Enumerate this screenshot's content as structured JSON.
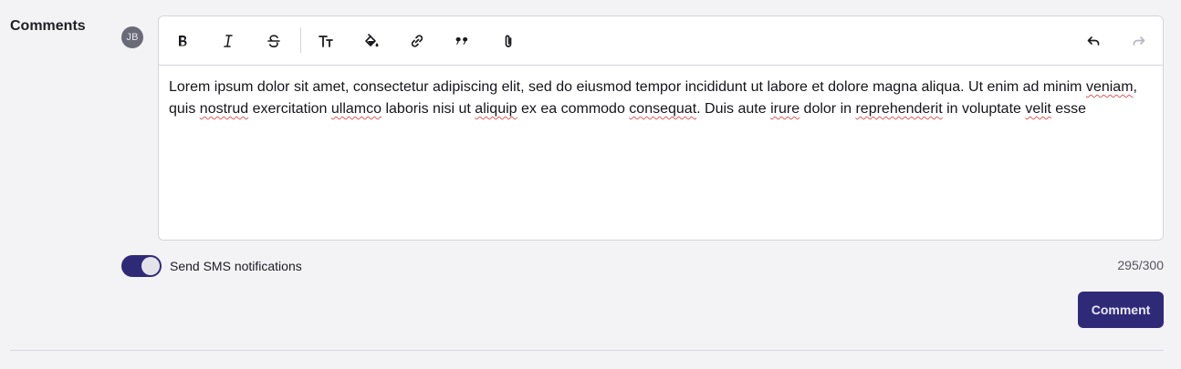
{
  "comments": {
    "section_label": "Comments",
    "avatar_initials": "JB",
    "toolbar": {
      "left_tools": [
        "bold-icon",
        "italic-icon",
        "strikethrough-icon",
        "text-size-icon",
        "fill-color-icon",
        "link-icon",
        "quote-icon",
        "attachment-icon"
      ],
      "right_tools": [
        "undo-icon",
        "redo-icon"
      ],
      "redo_enabled": false
    },
    "content_segments": [
      {
        "text": "Lorem ipsum dolor sit amet, consectetur adipiscing elit, sed do eiusmod tempor incididunt ut labore et dolore magna aliqua. Ut enim ad minim ",
        "misspelled": false
      },
      {
        "text": "veniam",
        "misspelled": true
      },
      {
        "text": ", quis ",
        "misspelled": false
      },
      {
        "text": "nostrud",
        "misspelled": true
      },
      {
        "text": " exercitation ",
        "misspelled": false
      },
      {
        "text": "ullamco",
        "misspelled": true
      },
      {
        "text": " laboris nisi ut ",
        "misspelled": false
      },
      {
        "text": "aliquip",
        "misspelled": true
      },
      {
        "text": " ex ea commodo ",
        "misspelled": false
      },
      {
        "text": "consequat",
        "misspelled": true
      },
      {
        "text": ". Duis aute ",
        "misspelled": false
      },
      {
        "text": "irure",
        "misspelled": true
      },
      {
        "text": " dolor in ",
        "misspelled": false
      },
      {
        "text": "reprehenderit",
        "misspelled": true
      },
      {
        "text": " in voluptate ",
        "misspelled": false
      },
      {
        "text": "velit",
        "misspelled": true
      },
      {
        "text": " esse",
        "misspelled": false
      }
    ],
    "sms_toggle": {
      "label": "Send SMS notifications",
      "enabled": true
    },
    "char_count": "295/300",
    "submit_label": "Comment"
  },
  "colors": {
    "accent": "#2f2a78",
    "background": "#f3f2f5",
    "border": "#d5d4da",
    "spellcheck": "#e05a5a"
  }
}
